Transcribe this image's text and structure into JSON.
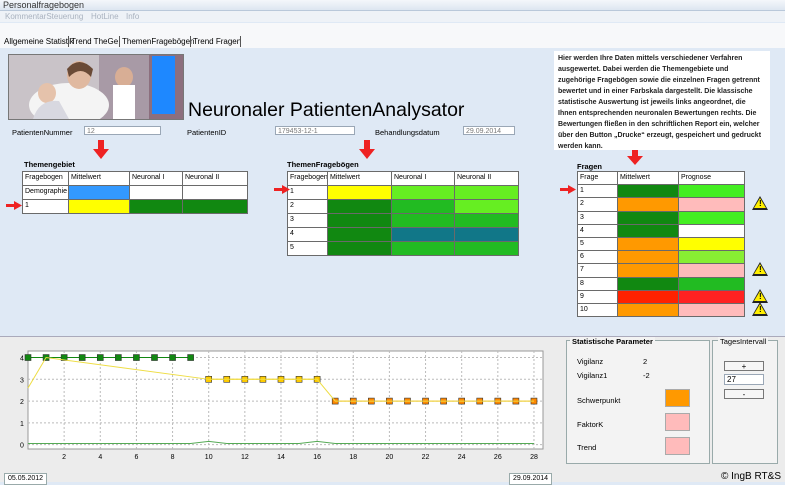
{
  "window": {
    "title": "Personalfragebogen"
  },
  "menu": [
    "KommentarSteuerung",
    "HotLine",
    "Info"
  ],
  "tabs": [
    "Allgemeine Statistik",
    "Trend TheGe",
    "ThemenFragebögen",
    "Trend Fragen"
  ],
  "app_title": "Neuronaler PatientenAnalysator",
  "patient": {
    "nummer_label": "PatientenNummer",
    "nummer_value": "12",
    "id_label": "PatientenID",
    "id_value": "179453-12-1",
    "datum_label": "Behandlungsdatum",
    "datum_value": "29.09.2014"
  },
  "info_text": "Hier werden Ihre Daten mittels verschiedener Verfahren ausgewertet. Dabei werden die Themengebiete und zugehörige Fragebögen sowie die einzelnen Fragen getrennt bewertet und in einer Farbskala dargestellt. Die klassische statistische Auswertung ist jeweils links angeordnet, die Ihnen entsprechenden neuronalen Bewertungen rechts. Die Bewertungen fließen in den schriftlichen Report ein, welcher über den Button „Drucke“ erzeugt, gespeichert und gedruckt werden kann.",
  "themengebiet": {
    "title": "Themengebiet",
    "headers": [
      "Fragebogen",
      "Mittelwert",
      "Neuronal I",
      "Neuronal II"
    ],
    "rows": [
      {
        "label": "Demographie",
        "colors": [
          "#3399ff",
          "#ffffff",
          "#ffffff"
        ]
      },
      {
        "label": "1",
        "colors": [
          "#ffff00",
          "#118811",
          "#118811"
        ]
      }
    ]
  },
  "themenfragebogen": {
    "title": "ThemenFragebögen",
    "headers": [
      "Fragebogen",
      "Mittelwert",
      "Neuronal I",
      "Neuronal II"
    ],
    "rows": [
      {
        "label": "1",
        "colors": [
          "#ffff00",
          "#66ee22",
          "#66ee22"
        ]
      },
      {
        "label": "2",
        "colors": [
          "#118811",
          "#22bb22",
          "#66ee22"
        ]
      },
      {
        "label": "3",
        "colors": [
          "#118811",
          "#22bb22",
          "#22bb22"
        ]
      },
      {
        "label": "4",
        "colors": [
          "#118811",
          "#117788",
          "#117788"
        ]
      },
      {
        "label": "5",
        "colors": [
          "#118811",
          "#22bb22",
          "#22bb22"
        ]
      }
    ]
  },
  "fragen": {
    "title": "Fragen",
    "headers": [
      "Frage",
      "Mittelwert",
      "Prognose"
    ],
    "rows": [
      {
        "label": "1",
        "colors": [
          "#118811",
          "#44ee22"
        ],
        "warn": false
      },
      {
        "label": "2",
        "colors": [
          "#ff9900",
          "#ffbbbb"
        ],
        "warn": true
      },
      {
        "label": "3",
        "colors": [
          "#118811",
          "#44ee22"
        ],
        "warn": false
      },
      {
        "label": "4",
        "colors": [
          "#118811",
          "#ffffff"
        ],
        "warn": false
      },
      {
        "label": "5",
        "colors": [
          "#ff9900",
          "#ffff00"
        ],
        "warn": false
      },
      {
        "label": "6",
        "colors": [
          "#ff9900",
          "#88ee33"
        ],
        "warn": false
      },
      {
        "label": "7",
        "colors": [
          "#ff9900",
          "#ffbbbb"
        ],
        "warn": true
      },
      {
        "label": "8",
        "colors": [
          "#118811",
          "#22bb22"
        ],
        "warn": false
      },
      {
        "label": "9",
        "colors": [
          "#ff2200",
          "#ff2222"
        ],
        "warn": true
      },
      {
        "label": "10",
        "colors": [
          "#ff9900",
          "#ffbbbb"
        ],
        "warn": true
      }
    ]
  },
  "chart_data": {
    "type": "line",
    "x_ticks": [
      2,
      4,
      6,
      8,
      10,
      12,
      14,
      16,
      18,
      20,
      22,
      24,
      26,
      28
    ],
    "y_ticks": [
      0,
      1,
      2,
      3,
      4
    ],
    "xlim": [
      0,
      28.5
    ],
    "ylim": [
      -0.2,
      4.3
    ],
    "grid": true,
    "series": [
      {
        "color": "#118811",
        "marker": "square",
        "x": [
          0,
          1,
          2,
          3,
          4,
          5,
          6,
          7,
          8,
          9
        ],
        "y": [
          4,
          4,
          4,
          4,
          4,
          4,
          4,
          4,
          4,
          4
        ]
      },
      {
        "color": "#ffcc00",
        "marker": "square",
        "x": [
          10,
          11,
          12,
          13,
          14,
          15,
          16
        ],
        "y": [
          3,
          3,
          3,
          3,
          3,
          3,
          3
        ]
      },
      {
        "color": "#ff8800",
        "marker": "square",
        "x": [
          17,
          18,
          19,
          20,
          21,
          22,
          23,
          24,
          25,
          26,
          27,
          28
        ],
        "y": [
          2,
          2,
          2,
          2,
          2,
          2,
          2,
          2,
          2,
          2,
          2,
          2
        ]
      },
      {
        "color": "#eedd44",
        "marker": "none",
        "x": [
          0,
          1,
          10,
          16,
          17,
          28
        ],
        "y": [
          2.6,
          4,
          3,
          3,
          2,
          2
        ]
      },
      {
        "color": "#55aa55",
        "marker": "none",
        "x": [
          0,
          9,
          10,
          11,
          15,
          16,
          17,
          28
        ],
        "y": [
          0.05,
          0.05,
          0.15,
          0.05,
          0.05,
          0.15,
          0.05,
          0.05
        ]
      }
    ]
  },
  "stats": {
    "title": "Statistische Parameter",
    "vigilanz_label": "Vigilanz",
    "vigilanz_value": "2",
    "vigilanz1_label": "Vigilanz1",
    "vigilanz1_value": "-2",
    "schwerpunkt_label": "Schwerpunkt",
    "schwerpunkt_color": "#ff9900",
    "faktork_label": "FaktorK",
    "faktork_color": "#ffbbbb",
    "trend_label": "Trend",
    "trend_color": "#ffbbbb"
  },
  "tagesintervall": {
    "title": "TagesIntervall",
    "plus_label": "+",
    "value": "27",
    "minus_label": "-"
  },
  "status": {
    "start_date": "05.05.2012",
    "end_date": "29.09.2014",
    "copyright": "© IngB RT&S"
  }
}
